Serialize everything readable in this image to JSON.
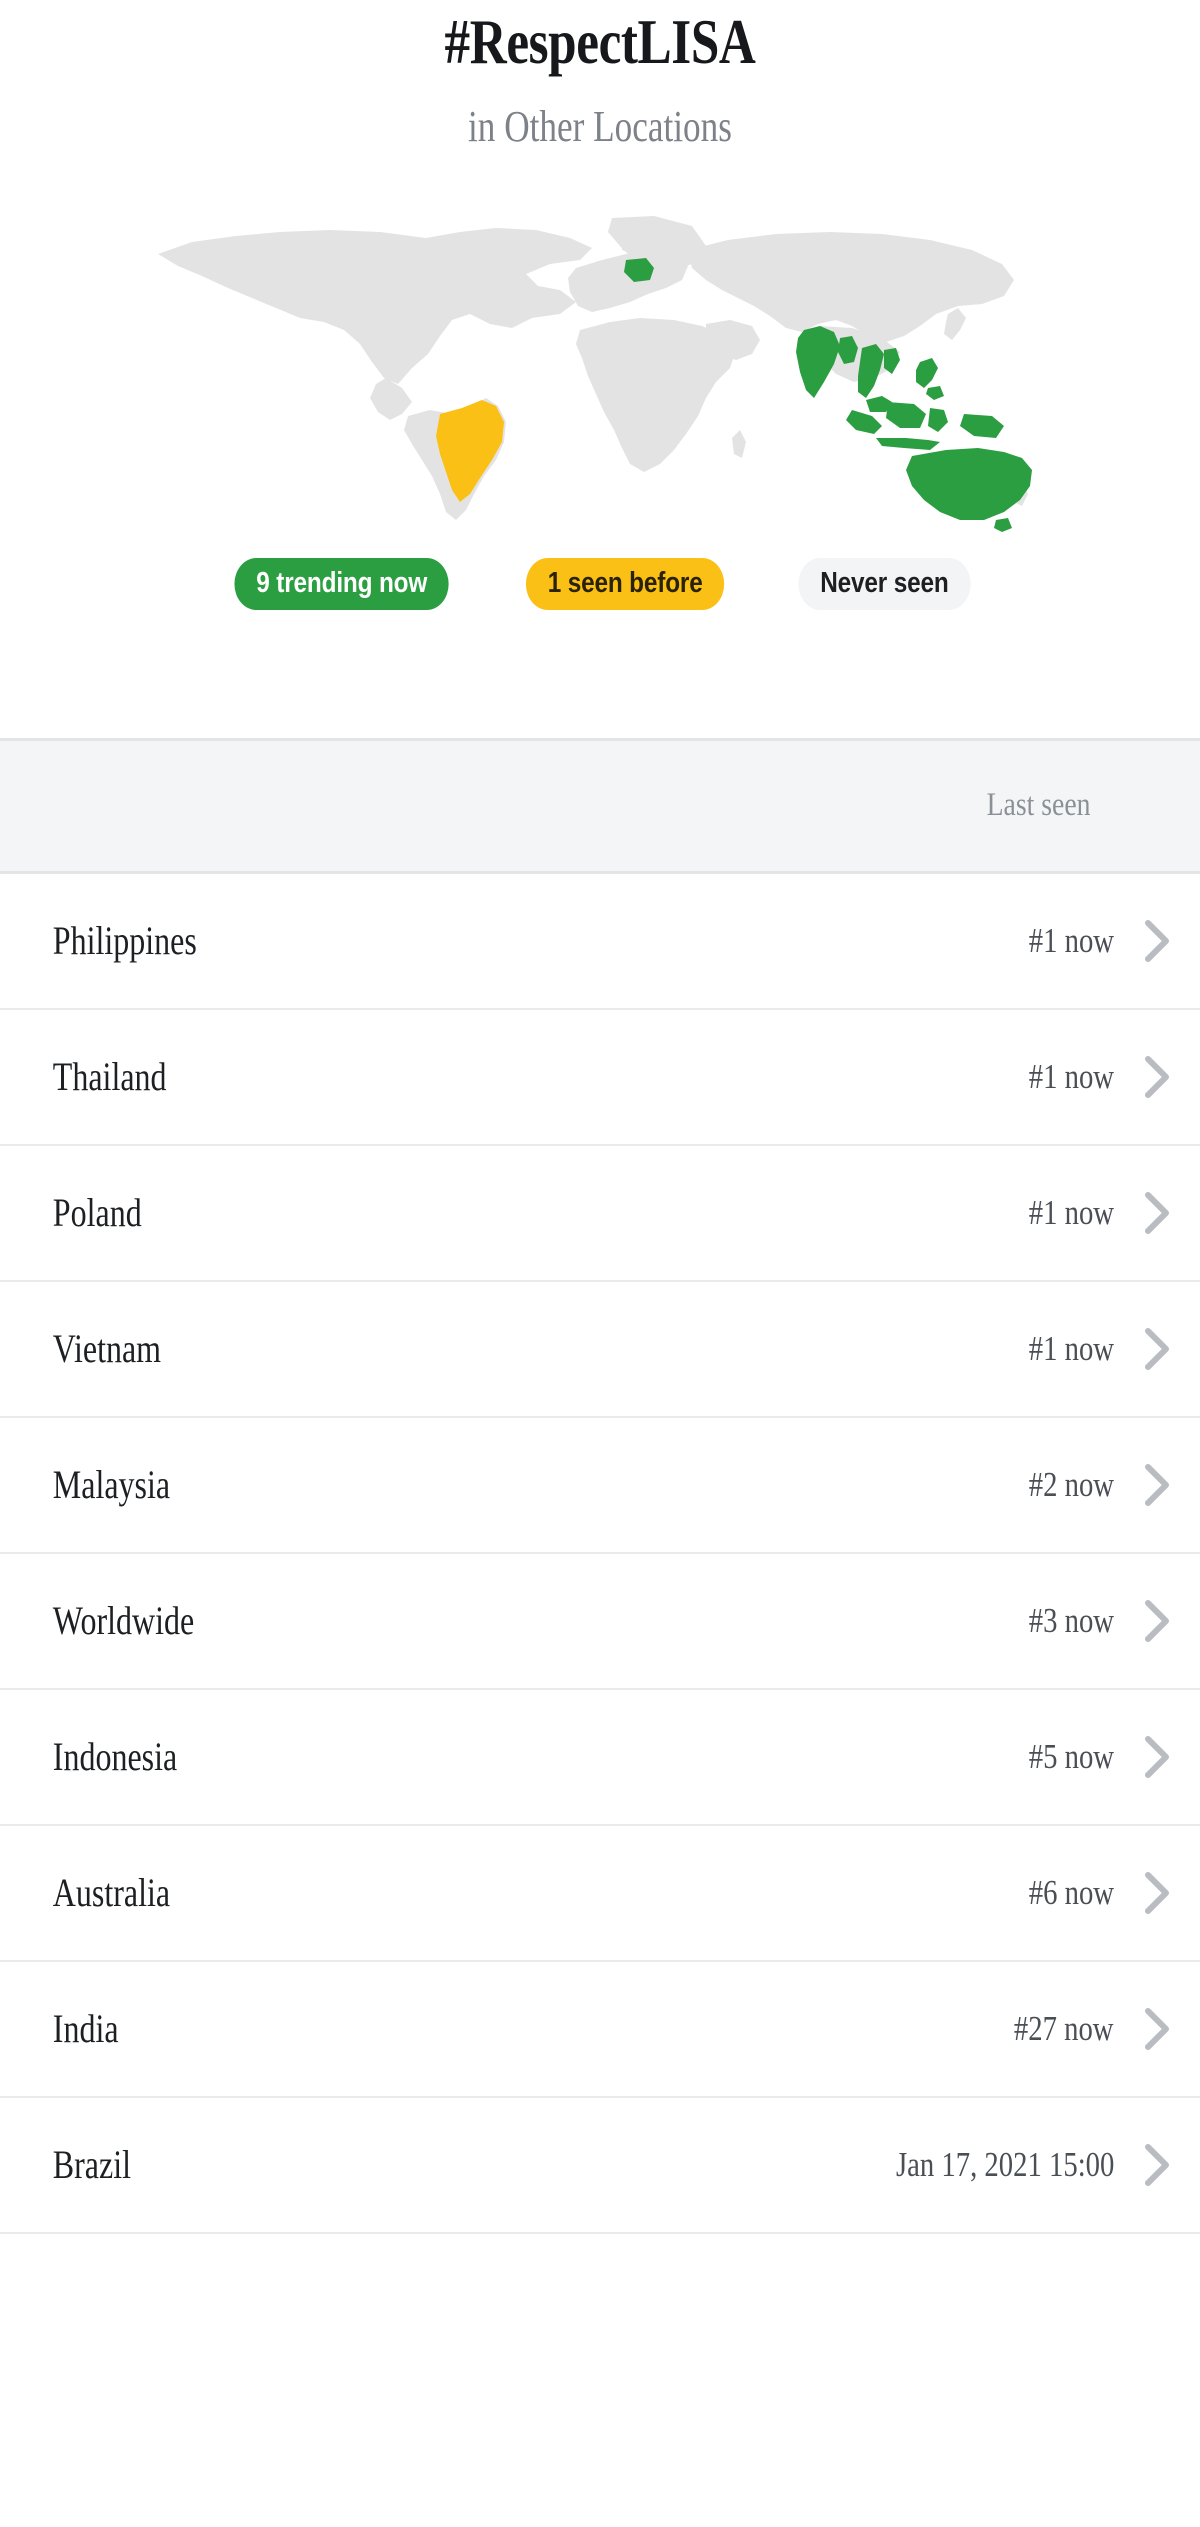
{
  "header": {
    "title": "#RespectLISA",
    "subtitle": "in Other Locations"
  },
  "map": {
    "legend": [
      {
        "id": "trending",
        "label": "9 trending now",
        "color": "#2b9e41"
      },
      {
        "id": "seen-before",
        "label": "1 seen before",
        "color": "#fbc015"
      },
      {
        "id": "never-seen",
        "label": "Never seen",
        "color": "#f3f4f6"
      }
    ],
    "highlight_colors": {
      "trending": "#2b9e41",
      "seen_before": "#fbc015",
      "never_seen": "#e3e3e3"
    },
    "trending_countries": [
      "Poland",
      "India",
      "Thailand",
      "Vietnam",
      "Malaysia",
      "Indonesia",
      "Philippines",
      "Australia"
    ],
    "seen_before_countries": [
      "Brazil"
    ]
  },
  "table": {
    "columns": [
      "",
      "Last seen"
    ],
    "header_last_seen": "Last seen",
    "rows": [
      {
        "name": "Philippines",
        "value": "#1 now",
        "status": "trending"
      },
      {
        "name": "Thailand",
        "value": "#1 now",
        "status": "trending"
      },
      {
        "name": "Poland",
        "value": "#1 now",
        "status": "trending"
      },
      {
        "name": "Vietnam",
        "value": "#1 now",
        "status": "trending"
      },
      {
        "name": "Malaysia",
        "value": "#2 now",
        "status": "trending"
      },
      {
        "name": "Worldwide",
        "value": "#3 now",
        "status": "trending"
      },
      {
        "name": "Indonesia",
        "value": "#5 now",
        "status": "trending"
      },
      {
        "name": "Australia",
        "value": "#6 now",
        "status": "trending"
      },
      {
        "name": "India",
        "value": "#27 now",
        "status": "trending"
      },
      {
        "name": "Brazil",
        "value": "Jan 17, 2021 15:00",
        "status": "seen-before"
      }
    ]
  },
  "icons": {
    "chevron": "chevron-right-icon"
  }
}
